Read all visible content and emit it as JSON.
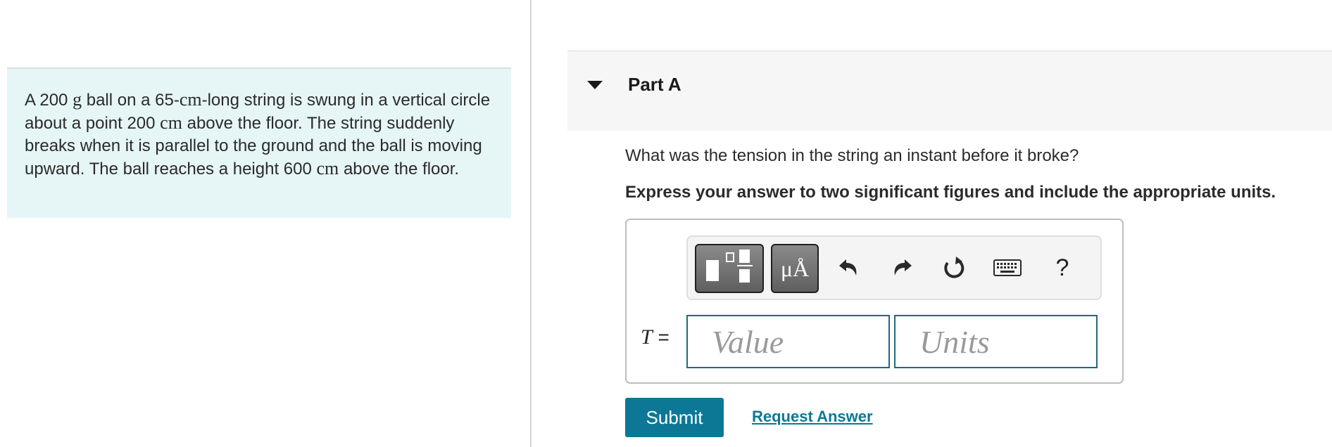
{
  "problem": {
    "segments": [
      {
        "text": "A 200 ",
        "math": false
      },
      {
        "text": "g",
        "math": true
      },
      {
        "text": " ball on a 65-",
        "math": false
      },
      {
        "text": "cm",
        "math": true
      },
      {
        "text": "-long string is swung in a vertical circle about a point 200 ",
        "math": false
      },
      {
        "text": "cm",
        "math": true
      },
      {
        "text": " above the floor. The string suddenly breaks when it is parallel to the ground and the ball is moving upward. The ball reaches a height 600 ",
        "math": false
      },
      {
        "text": "cm",
        "math": true
      },
      {
        "text": " above the floor.",
        "math": false
      }
    ]
  },
  "part": {
    "title": "Part A",
    "question": "What was the tension in the string an instant before it broke?",
    "instruction": "Express your answer to two significant figures and include the appropriate units."
  },
  "toolbar": {
    "templates_icon": "templates-icon",
    "units_label": "μÅ",
    "undo_icon": "undo-icon",
    "redo_icon": "redo-icon",
    "reset_icon": "reset-icon",
    "keyboard_icon": "keyboard-icon",
    "help_label": "?"
  },
  "answer": {
    "variable": "T",
    "equals": "=",
    "value_placeholder": "Value",
    "units_placeholder": "Units"
  },
  "actions": {
    "submit_label": "Submit",
    "request_label": "Request Answer"
  },
  "colors": {
    "problem_bg": "#e6f5f5",
    "accent": "#0c7896",
    "input_border": "#1f6b77"
  }
}
